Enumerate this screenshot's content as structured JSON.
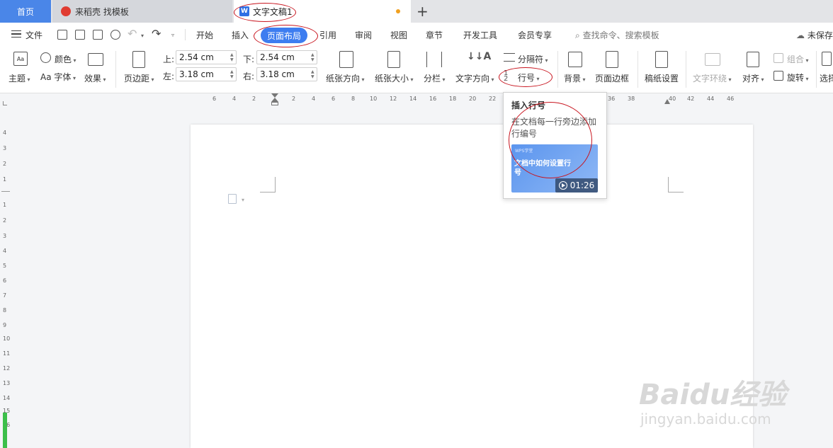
{
  "tabs": {
    "home": "首页",
    "daoke": "来稻壳 找模板",
    "doc": "文字文稿1",
    "doc_logo": "W"
  },
  "menu": {
    "file": "文件",
    "items": [
      "开始",
      "插入",
      "页面布局",
      "引用",
      "审阅",
      "视图",
      "章节",
      "开发工具",
      "会员专享"
    ],
    "active": "页面布局",
    "search": "查找命令、搜索模板",
    "unsaved": "未保存"
  },
  "ribbon": {
    "theme": "主题",
    "color": "颜色",
    "font": "字体",
    "font_prefix": "Aa",
    "effect": "效果",
    "margins": "页边距",
    "top_label": "上:",
    "top_value": "2.54 cm",
    "bottom_label": "下:",
    "bottom_value": "2.54 cm",
    "left_label": "左:",
    "left_value": "3.18 cm",
    "right_label": "右:",
    "right_value": "3.18 cm",
    "orientation": "纸张方向",
    "size": "纸张大小",
    "columns": "分栏",
    "text_direction": "文字方向",
    "breaks": "分隔符",
    "line_numbers": "行号",
    "background": "背景",
    "page_border": "页面边框",
    "manuscript": "稿纸设置",
    "wrap": "文字环绕",
    "align": "对齐",
    "group": "组合",
    "rotate": "旋转",
    "select": "选择"
  },
  "ruler": {
    "h": [
      "6",
      "4",
      "2",
      "2",
      "4",
      "6",
      "8",
      "10",
      "12",
      "14",
      "16",
      "18",
      "20",
      "22",
      "36",
      "38",
      "40",
      "42",
      "44",
      "46"
    ],
    "v": [
      "4",
      "3",
      "2",
      "1",
      "1",
      "2",
      "3",
      "4",
      "5",
      "6",
      "7",
      "8",
      "9",
      "10",
      "11",
      "12",
      "13",
      "14",
      "15",
      "16"
    ]
  },
  "tooltip": {
    "title": "插入行号",
    "desc": "在文档每一行旁边添加行编号",
    "brand": "WPS学堂",
    "video_title": "文档中如何设置行号",
    "duration": "01:26"
  },
  "watermark": {
    "main": "Baidu经验",
    "sub": "jingyan.baidu.com"
  },
  "colors": {
    "accent": "#3d7df0",
    "annotation": "#c8141e"
  }
}
